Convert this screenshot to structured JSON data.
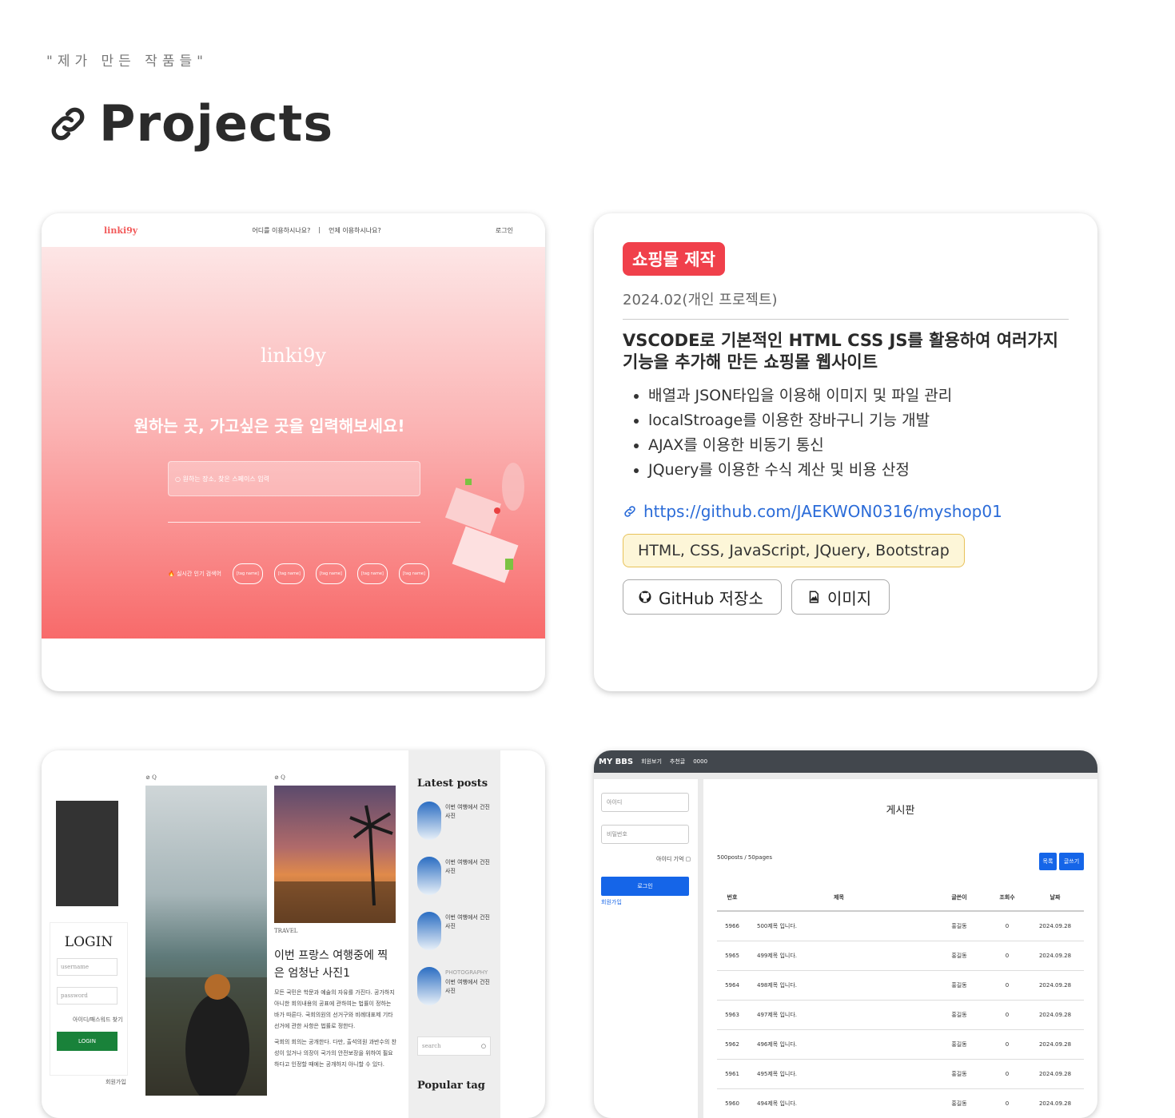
{
  "header": {
    "subtitle": "\"제가 만든 작품들\"",
    "title": "Projects",
    "icon": "link-icon"
  },
  "project1_screenshot": {
    "logo": "linki9y",
    "nav_items": [
      "어디를 이용하시나요?",
      "언제 이용하시나요?"
    ],
    "login": "로그인",
    "hero_logo": "linki9y",
    "hero_text": "원하는 곳, 가고싶은 곳을 입력해보세요!",
    "search_placeholder": "원하는 장소, 찾은 스페이스 입력",
    "trending_label": "실시간 인기 검색어",
    "tags": [
      "[tag name]",
      "[tag name]",
      "[tag name]",
      "[tag name]",
      "[tag name]"
    ]
  },
  "project2": {
    "badge": "쇼핑몰 제작",
    "date": "2024.02(개인 프로젝트)",
    "description": "VSCODE로 기본적인 HTML CSS JS를 활용하여 여러가지 기능을 추가해 만든 쇼핑몰 웹사이트",
    "features": [
      "배열과 JSON타입을 이용해 이미지 및 파일 관리",
      "localStroage를 이용한 장바구니 기능 개발",
      "AJAX를 이용한 비동기 통신",
      "JQuery를 이용한 수식 계산 및 비용 산정"
    ],
    "link": "https://github.com/JAEKWON0316/myshop01",
    "tech": "HTML, CSS, JavaScript, JQuery, Bootstrap",
    "github_button": "GitHub 저장소",
    "image_button": "이미지",
    "badge_color": "#f0404b",
    "link_color": "#2a6bd8"
  },
  "project3_screenshot": {
    "login_title": "LOGIN",
    "username_placeholder": "username",
    "password_placeholder": "password",
    "find_text": "아이디/패스워드 찾기",
    "login_button": "LOGIN",
    "join_text": "회원가입",
    "category1": "TRAVEL",
    "post_title": "이번 프랑스 여행중에 찍은 엄청난 사진1",
    "post_text": "모든 국민은 학문과 예술의 자유를 가진다. 공가하지 아니한 회의내용의 공표에 관하여는 법률이 정하는 바가 따른다. 국회의원의 선거구와 비례대표제 기타 선거에 관한 사항은 법률로 정한다.",
    "post_text2": "국회의 회의는 공개한다. 다만, 출석의원 과반수의 찬성이 있거나 의장이 국가의 안전보장을 위하여 필요하다고 인정할 때에는 공개하지 아니할 수 있다.",
    "latest_posts_title": "Latest posts",
    "latest_posts": [
      "이번 여행에서 건진 사진",
      "이번 여행에서 건진 사진",
      "이번 여행에서 건진 사진",
      "이번 여행에서 건진 사진"
    ],
    "photography_label": "PHOTOGRAPHY",
    "search_placeholder": "search",
    "popular_tag_title": "Popular tag",
    "meta_icons": "⊘ Q"
  },
  "project4_screenshot": {
    "brand": "MY BBS",
    "nav_items": [
      "회원보기",
      "추천글",
      "0000"
    ],
    "id_placeholder": "아이디",
    "pw_placeholder": "비밀번호",
    "remember": "아이디 기억",
    "login_button": "로그인",
    "join_link": "회원가입",
    "board_title": "게시판",
    "page_info": "500posts / 50pages",
    "list_button": "목록",
    "write_button": "글쓰기",
    "columns": [
      "번호",
      "제목",
      "글쓴이",
      "조회수",
      "날짜"
    ],
    "rows": [
      [
        "5966",
        "500제목 입니다.",
        "홍길동",
        "0",
        "2024.09.28"
      ],
      [
        "5965",
        "499제목 입니다.",
        "홍길동",
        "0",
        "2024.09.28"
      ],
      [
        "5964",
        "498제목 입니다.",
        "홍길동",
        "0",
        "2024.09.28"
      ],
      [
        "5963",
        "497제목 입니다.",
        "홍길동",
        "0",
        "2024.09.28"
      ],
      [
        "5962",
        "496제목 입니다.",
        "홍길동",
        "0",
        "2024.09.28"
      ],
      [
        "5961",
        "495제목 입니다.",
        "홍길동",
        "0",
        "2024.09.28"
      ],
      [
        "5960",
        "494제목 입니다.",
        "홍길동",
        "0",
        "2024.09.28"
      ]
    ]
  }
}
